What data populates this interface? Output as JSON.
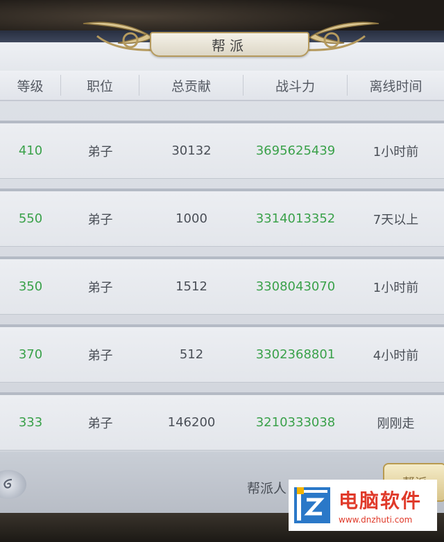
{
  "window": {
    "title": "帮派"
  },
  "table": {
    "headers": [
      "等级",
      "职位",
      "总贡献",
      "战斗力",
      "离线时间"
    ],
    "rows": [
      {
        "level": "410",
        "position": "弟子",
        "contribution": "30132",
        "power": "3695625439",
        "offline": "1小时前"
      },
      {
        "level": "550",
        "position": "弟子",
        "contribution": "1000",
        "power": "3314013352",
        "offline": "7天以上"
      },
      {
        "level": "350",
        "position": "弟子",
        "contribution": "1512",
        "power": "3308043070",
        "offline": "1小时前"
      },
      {
        "level": "370",
        "position": "弟子",
        "contribution": "512",
        "power": "3302368801",
        "offline": "4小时前"
      },
      {
        "level": "333",
        "position": "弟子",
        "contribution": "146200",
        "power": "3210333038",
        "offline": "刚刚走"
      }
    ]
  },
  "footer": {
    "member_label": "帮派人",
    "gold_button_label": "帮派"
  },
  "watermark": {
    "title": "电脑软件",
    "url": "www.dnzhuti.com"
  },
  "colors": {
    "green_value": "#3aa14a",
    "header_text": "#555a63",
    "watermark_red": "#e03a2a"
  }
}
